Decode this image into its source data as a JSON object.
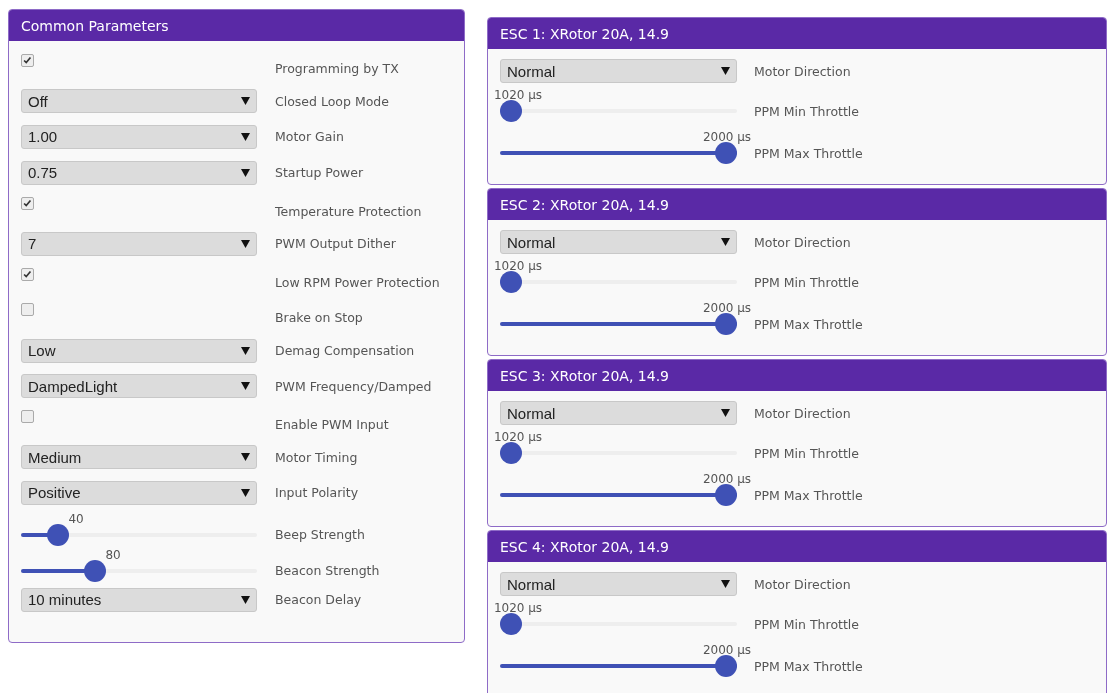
{
  "common": {
    "title": "Common Parameters",
    "rows": [
      {
        "kind": "checkbox",
        "checked": true,
        "label": "Programming by TX"
      },
      {
        "kind": "select",
        "value": "Off",
        "label": "Closed Loop Mode"
      },
      {
        "kind": "select",
        "value": "1.00",
        "label": "Motor Gain"
      },
      {
        "kind": "select",
        "value": "0.75",
        "label": "Startup Power"
      },
      {
        "kind": "checkbox",
        "checked": true,
        "label": "Temperature Protection"
      },
      {
        "kind": "select",
        "value": "7",
        "label": "PWM Output Dither"
      },
      {
        "kind": "checkbox",
        "checked": true,
        "label": "Low RPM Power Protection"
      },
      {
        "kind": "checkbox",
        "checked": false,
        "label": "Brake on Stop"
      },
      {
        "kind": "select",
        "value": "Low",
        "label": "Demag Compensation"
      },
      {
        "kind": "select",
        "value": "DampedLight",
        "label": "PWM Frequency/Damped"
      },
      {
        "kind": "checkbox",
        "checked": false,
        "label": "Enable PWM Input"
      },
      {
        "kind": "select",
        "value": "Medium",
        "label": "Motor Timing"
      },
      {
        "kind": "select",
        "value": "Positive",
        "label": "Input Polarity"
      },
      {
        "kind": "slider",
        "reading": "40",
        "level": 0.157,
        "label": "Beep Strength"
      },
      {
        "kind": "slider",
        "reading": "80",
        "level": 0.314,
        "label": "Beacon Strength"
      },
      {
        "kind": "select",
        "value": "10 minutes",
        "label": "Beacon Delay"
      }
    ]
  },
  "escs": [
    {
      "title": "ESC 1: XRotor 20A, 14.9",
      "direction": {
        "value": "Normal",
        "label": "Motor Direction"
      },
      "min": {
        "reading": "1020 µs",
        "level": 0,
        "label": "PPM Min Throttle"
      },
      "max": {
        "reading": "2000 µs",
        "level": 1,
        "label": "PPM Max Throttle"
      }
    },
    {
      "title": "ESC 2: XRotor 20A, 14.9",
      "direction": {
        "value": "Normal",
        "label": "Motor Direction"
      },
      "min": {
        "reading": "1020 µs",
        "level": 0,
        "label": "PPM Min Throttle"
      },
      "max": {
        "reading": "2000 µs",
        "level": 1,
        "label": "PPM Max Throttle"
      }
    },
    {
      "title": "ESC 3: XRotor 20A, 14.9",
      "direction": {
        "value": "Normal",
        "label": "Motor Direction"
      },
      "min": {
        "reading": "1020 µs",
        "level": 0,
        "label": "PPM Min Throttle"
      },
      "max": {
        "reading": "2000 µs",
        "level": 1,
        "label": "PPM Max Throttle"
      }
    },
    {
      "title": "ESC 4: XRotor 20A, 14.9",
      "direction": {
        "value": "Normal",
        "label": "Motor Direction"
      },
      "min": {
        "reading": "1020 µs",
        "level": 0,
        "label": "PPM Min Throttle"
      },
      "max": {
        "reading": "2000 µs",
        "level": 1,
        "label": "PPM Max Throttle"
      }
    }
  ]
}
